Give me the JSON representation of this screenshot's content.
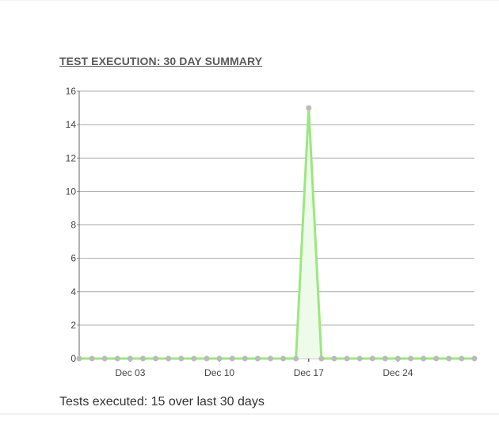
{
  "widget": {
    "title": "TEST EXECUTION: 30 DAY SUMMARY",
    "summary_prefix": "Tests executed: ",
    "summary_count": "15",
    "summary_suffix": " over last 30 days"
  },
  "chart_data": {
    "type": "area",
    "title": "",
    "xlabel": "",
    "ylabel": "",
    "x_tick_labels": [
      "Dec 03",
      "Dec 10",
      "Dec 17",
      "Dec 24"
    ],
    "x_tick_dates": [
      "Dec 03",
      "Dec 10",
      "Dec 17",
      "Dec 24"
    ],
    "x": [
      "Nov 29",
      "Nov 30",
      "Dec 01",
      "Dec 02",
      "Dec 03",
      "Dec 04",
      "Dec 05",
      "Dec 06",
      "Dec 07",
      "Dec 08",
      "Dec 09",
      "Dec 10",
      "Dec 11",
      "Dec 12",
      "Dec 13",
      "Dec 14",
      "Dec 15",
      "Dec 16",
      "Dec 17",
      "Dec 18",
      "Dec 19",
      "Dec 20",
      "Dec 21",
      "Dec 22",
      "Dec 23",
      "Dec 24",
      "Dec 25",
      "Dec 26",
      "Dec 27",
      "Dec 28",
      "Dec 29",
      "Dec 30"
    ],
    "series": [
      {
        "values": [
          0,
          0,
          0,
          0,
          0,
          0,
          0,
          0,
          0,
          0,
          0,
          0,
          0,
          0,
          0,
          0,
          0,
          0,
          15,
          0,
          0,
          0,
          0,
          0,
          0,
          0,
          0,
          0,
          0,
          0,
          0,
          0
        ],
        "line_color": "#9be77f",
        "fill_color": "#effbea",
        "marker_color": "#bbbbbb"
      }
    ],
    "ylim": [
      0,
      16
    ],
    "y_ticks": [
      0,
      2,
      4,
      6,
      8,
      10,
      12,
      14,
      16
    ],
    "grid": true,
    "legend": "none"
  }
}
